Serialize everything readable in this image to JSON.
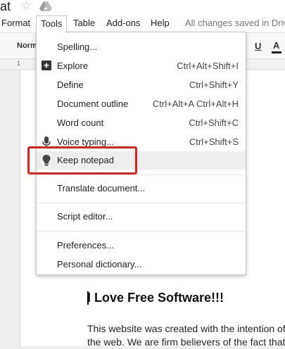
{
  "title_fragment": "at",
  "menubar": {
    "items": [
      "Format",
      "Tools",
      "Table",
      "Add-ons",
      "Help"
    ],
    "status": "All changes saved in Drive"
  },
  "toolbar": {
    "style_select": "Normal text",
    "underline_label": "U",
    "text_color_label": "A"
  },
  "ruler": {
    "mark": "1"
  },
  "tools_menu": {
    "items": [
      {
        "label": "Spelling...",
        "shortcut": ""
      },
      {
        "label": "Explore",
        "shortcut": "Ctrl+Alt+Shift+I"
      },
      {
        "label": "Define",
        "shortcut": "Ctrl+Shift+Y"
      },
      {
        "label": "Document outline",
        "shortcut": "Ctrl+Alt+A Ctrl+Alt+H"
      },
      {
        "label": "Word count",
        "shortcut": "Ctrl+Shift+C"
      },
      {
        "label": "Voice typing...",
        "shortcut": "Ctrl+Shift+S"
      },
      {
        "label": "Keep notepad",
        "shortcut": ""
      },
      {
        "label": "Translate document...",
        "shortcut": ""
      },
      {
        "label": "Script editor...",
        "shortcut": ""
      },
      {
        "label": "Preferences...",
        "shortcut": ""
      },
      {
        "label": "Personal dictionary...",
        "shortcut": ""
      }
    ]
  },
  "document": {
    "heading": "I Love Free Software!!!",
    "body_line1": "This website was created with the intention of",
    "body_line2": "the web. We are firm believers of the fact that"
  },
  "colors": {
    "annotation": "#e0201a",
    "highlight": "#eeeeee"
  },
  "icons": [
    "star-icon",
    "drive-icon",
    "explore-icon",
    "microphone-icon",
    "lightbulb-icon"
  ]
}
